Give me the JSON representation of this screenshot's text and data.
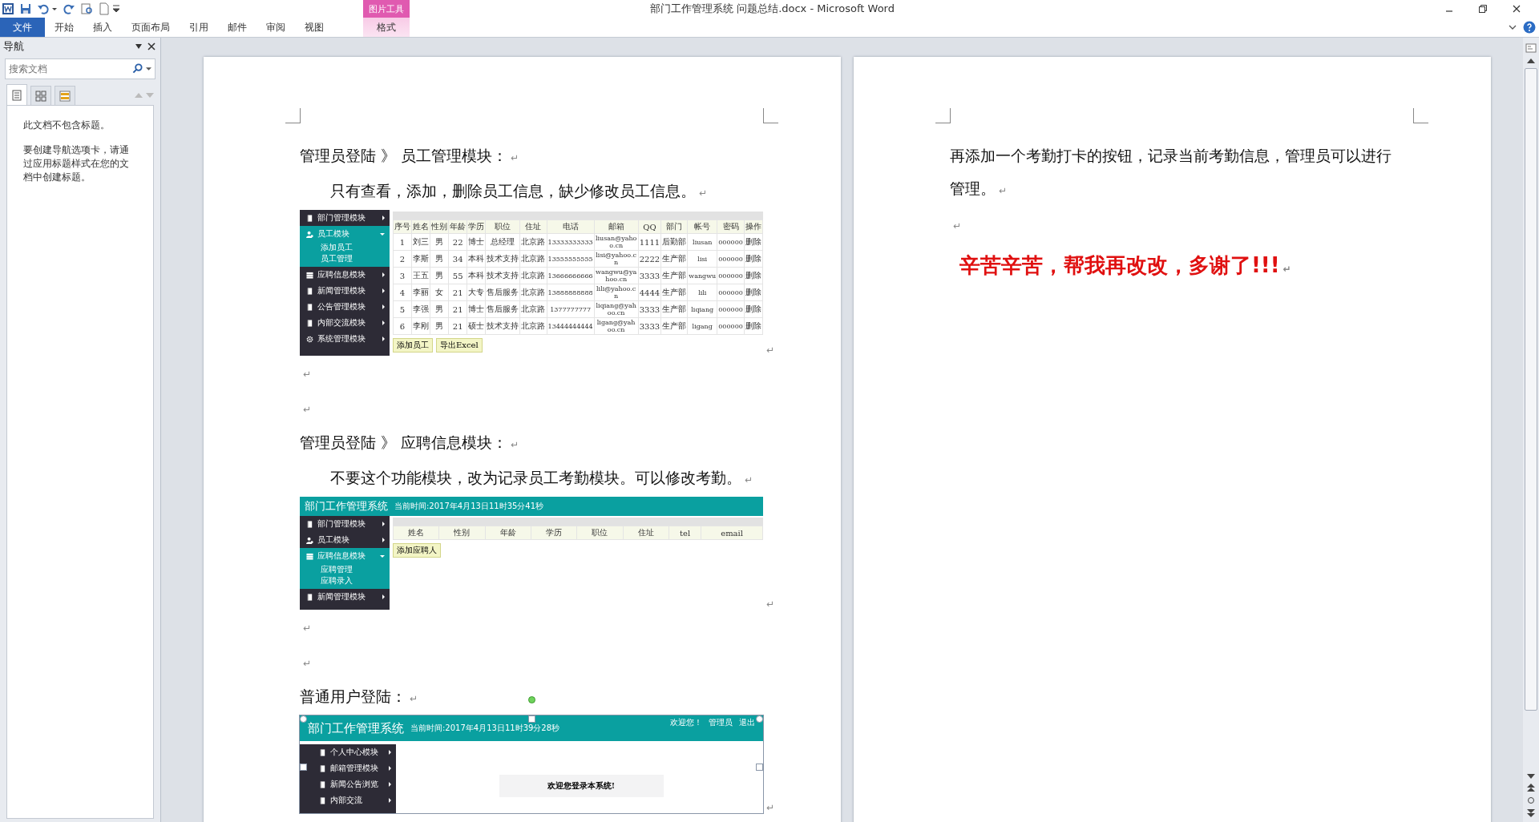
{
  "window": {
    "title": "部门工作管理系统  问题总结.docx  -  Microsoft Word"
  },
  "ribbon": {
    "tabs": [
      {
        "label": "文件",
        "kind": "file",
        "selected": false
      },
      {
        "label": "开始",
        "kind": "normal",
        "selected": false
      },
      {
        "label": "插入",
        "kind": "normal",
        "selected": false
      },
      {
        "label": "页面布局",
        "kind": "normal",
        "selected": false
      },
      {
        "label": "引用",
        "kind": "normal",
        "selected": false
      },
      {
        "label": "邮件",
        "kind": "normal",
        "selected": false
      },
      {
        "label": "审阅",
        "kind": "normal",
        "selected": false
      },
      {
        "label": "视图",
        "kind": "normal",
        "selected": false
      }
    ],
    "contextual": {
      "group": "图片工具",
      "tab": {
        "label": "格式",
        "selected": false
      }
    }
  },
  "navigation": {
    "title": "导航",
    "search": {
      "placeholder": "搜索文档"
    },
    "views": [
      {
        "kind": "headings",
        "selected": true
      },
      {
        "kind": "pages",
        "selected": false
      },
      {
        "kind": "results",
        "selected": false
      }
    ],
    "messages": [
      "此文档不包含标题。",
      "要创建导航选项卡，请通过应用标题样式在您的文档中创建标题。"
    ]
  },
  "pages": [
    {
      "blocks": [
        {
          "kind": "heading",
          "text": "管理员登陆 》 员工管理模块：",
          "mark": "↵"
        },
        {
          "kind": "indent",
          "text": "只有查看，添加，删除员工信息，缺少修改员工信息。",
          "mark": "↵"
        },
        {
          "kind": "image",
          "selected": false,
          "mark": "↵",
          "app": {
            "sidebar": [
              {
                "label": "部门管理模块",
                "kind": "book",
                "expanded": false
              },
              {
                "label": "员工模块",
                "kind": "user",
                "expanded": true,
                "children": [
                  "添加员工",
                  "员工管理"
                ]
              },
              {
                "label": "应聘信息模块",
                "kind": "stack",
                "expanded": false
              },
              {
                "label": "新闻管理模块",
                "kind": "book",
                "expanded": false
              },
              {
                "label": "公告管理模块",
                "kind": "book",
                "expanded": false
              },
              {
                "label": "内部交流模块",
                "kind": "book",
                "expanded": false
              },
              {
                "label": "系统管理模块",
                "kind": "gear",
                "expanded": false
              }
            ],
            "table": {
              "columns": [
                "序号",
                "姓名",
                "性别",
                "年龄",
                "学历",
                "职位",
                "住址",
                "电话",
                "邮箱",
                "QQ",
                "部门",
                "帐号",
                "密码",
                "操作"
              ],
              "rows": [
                [
                  "1",
                  "刘三",
                  "男",
                  "22",
                  "博士",
                  "总经理",
                  "北京路",
                  "13333333333",
                  "liusan@yahoo.cn",
                  "1111",
                  "后勤部",
                  "liusan",
                  "000000",
                  "删除"
                ],
                [
                  "2",
                  "李斯",
                  "男",
                  "34",
                  "本科",
                  "技术支持",
                  "北京路",
                  "13555555555",
                  "lisi@yahoo.cn",
                  "2222",
                  "生产部",
                  "lisi",
                  "000000",
                  "删除"
                ],
                [
                  "3",
                  "王五",
                  "男",
                  "55",
                  "本科",
                  "技术支持",
                  "北京路",
                  "13666666666",
                  "wangwu@yahoo.cn",
                  "3333",
                  "生产部",
                  "wangwu",
                  "000000",
                  "删除"
                ],
                [
                  "4",
                  "李丽",
                  "女",
                  "21",
                  "大专",
                  "售后服务",
                  "北京路",
                  "13888888888",
                  "lili@yahoo.cn",
                  "4444",
                  "生产部",
                  "lili",
                  "000000",
                  "删除"
                ],
                [
                  "5",
                  "李强",
                  "男",
                  "21",
                  "博士",
                  "售后服务",
                  "北京路",
                  "1377777777",
                  "liqiang@yahoo.cn",
                  "3333",
                  "生产部",
                  "liqiang",
                  "000000",
                  "删除"
                ],
                [
                  "6",
                  "李刚",
                  "男",
                  "21",
                  "硕士",
                  "技术支持",
                  "北京路",
                  "13444444444",
                  "ligang@yahoo.cn",
                  "3333",
                  "生产部",
                  "ligang",
                  "000000",
                  "删除"
                ]
              ]
            },
            "buttons": [
              "添加员工",
              "导出Excel"
            ]
          }
        },
        {
          "kind": "empty",
          "mark": "↵"
        },
        {
          "kind": "empty",
          "mark": "↵"
        },
        {
          "kind": "heading",
          "text": "管理员登陆 》 应聘信息模块：",
          "mark": "↵"
        },
        {
          "kind": "indent",
          "text": "不要这个功能模块，改为记录员工考勤模块。可以修改考勤。",
          "mark": "↵"
        },
        {
          "kind": "image",
          "selected": false,
          "mark": "↵",
          "app": {
            "header": {
              "title": "部门工作管理系统",
              "time": "当前时间:2017年4月13日11时35分41秒"
            },
            "sidebar": [
              {
                "label": "部门管理模块",
                "kind": "book",
                "expanded": false
              },
              {
                "label": "员工模块",
                "kind": "user",
                "expanded": false
              },
              {
                "label": "应聘信息模块",
                "kind": "stack",
                "expanded": true,
                "children": [
                  "应聘管理",
                  "应聘录入"
                ]
              },
              {
                "label": "新闻管理模块",
                "kind": "book",
                "expanded": false
              }
            ],
            "table": {
              "columns": [
                "姓名",
                "性别",
                "年龄",
                "学历",
                "职位",
                "住址",
                "tel",
                "email"
              ]
            },
            "buttons": [
              "添加应聘人"
            ]
          }
        },
        {
          "kind": "empty",
          "mark": "↵"
        },
        {
          "kind": "empty",
          "mark": "↵"
        },
        {
          "kind": "heading",
          "text": "普通用户登陆：",
          "mark": "↵"
        },
        {
          "kind": "image",
          "selected": true,
          "mark": "↵",
          "app": {
            "header": {
              "title": "部门工作管理系统",
              "time": "当前时间:2017年4月13日11时39分28秒",
              "links": [
                "欢迎您！",
                "管理员",
                "退出"
              ]
            },
            "sidebar": [
              {
                "label": "个人中心模块",
                "kind": "book",
                "expanded": false
              },
              {
                "label": "邮箱管理模块",
                "kind": "book",
                "expanded": false
              },
              {
                "label": "新闻公告浏览",
                "kind": "book",
                "expanded": false
              },
              {
                "label": "内部交流",
                "kind": "book",
                "expanded": false
              }
            ],
            "welcome": "欢迎您登录本系统!"
          }
        }
      ]
    },
    {
      "blocks": [
        {
          "kind": "plain",
          "text": "再添加一个考勤打卡的按钮，记录当前考勤信息，管理员可以进行管理。",
          "mark": "↵"
        },
        {
          "kind": "empty",
          "mark": "↵"
        },
        {
          "kind": "emphasis",
          "text": "辛苦辛苦，帮我再改改，多谢了!!!",
          "mark": "↵"
        }
      ]
    }
  ]
}
